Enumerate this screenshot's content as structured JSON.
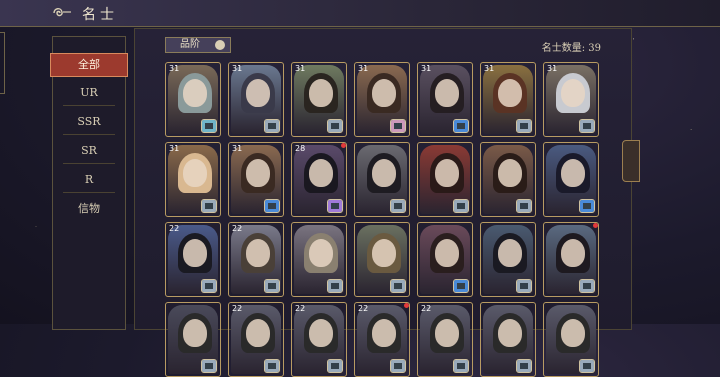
{
  "header": {
    "title": "名士"
  },
  "sidebar": {
    "items": [
      {
        "label": "全部",
        "selected": true
      },
      {
        "label": "UR"
      },
      {
        "label": "SSR"
      },
      {
        "label": "SR"
      },
      {
        "label": "R"
      },
      {
        "label": "信物"
      }
    ]
  },
  "filter": {
    "label": "品阶"
  },
  "count_text": "名士数量: 39",
  "cards": [
    {
      "level": "31",
      "hair": "#8a9a9a",
      "bg": "#7a6a58",
      "badge": "#6fb4c9"
    },
    {
      "level": "31",
      "hair": "#3a3a4a",
      "bg": "#6a7890",
      "badge": "#9ab"
    },
    {
      "level": "31",
      "hair": "#2a2520",
      "bg": "#6f7a60",
      "badge": "#9ab"
    },
    {
      "level": "31",
      "hair": "#3a2a22",
      "bg": "#8a6a50",
      "badge": "#c9b"
    },
    {
      "level": "31",
      "hair": "#251e22",
      "bg": "#5a5060",
      "badge": "#4a8ad8"
    },
    {
      "level": "31",
      "hair": "#5a3324",
      "bg": "#8a7040",
      "badge": "#9ab"
    },
    {
      "level": "31",
      "hair": "#c8cad0",
      "bg": "#7a7064",
      "badge": "#9ab"
    },
    {
      "level": "31",
      "hair": "#d9b890",
      "bg": "#8a6a4a",
      "badge": "#9ab"
    },
    {
      "level": "31",
      "hair": "#3a2a22",
      "bg": "#8a6a50",
      "badge": "#4a8ad8"
    },
    {
      "level": "28",
      "hair": "#1a1820",
      "bg": "#5a4a6a",
      "badge": "#a07ad8",
      "dot": true
    },
    {
      "level": "",
      "hair": "#1e1c22",
      "bg": "#6a6a70",
      "badge": "#9ab"
    },
    {
      "level": "",
      "hair": "#2a1a18",
      "bg": "#8a3a34",
      "badge": "#9ab"
    },
    {
      "level": "",
      "hair": "#2a1c18",
      "bg": "#7a5a48",
      "badge": "#9ab"
    },
    {
      "level": "",
      "hair": "#1a1a2a",
      "bg": "#4a5a80",
      "badge": "#4a8ad8"
    },
    {
      "level": "22",
      "hair": "#1a1a22",
      "bg": "#4a5a8a",
      "badge": "#9ab"
    },
    {
      "level": "22",
      "hair": "#4a4038",
      "bg": "#7a7a8a",
      "badge": "#9ab"
    },
    {
      "level": "",
      "hair": "#8a8070",
      "bg": "#7a7480",
      "badge": "#9ab"
    },
    {
      "level": "",
      "hair": "#6a5a40",
      "bg": "#6a7060",
      "badge": "#9ab"
    },
    {
      "level": "",
      "hair": "#2a1e1e",
      "bg": "#6a4a5a",
      "badge": "#4a8ad8"
    },
    {
      "level": "",
      "hair": "#1a1a22",
      "bg": "#4a5a70",
      "badge": "#9ab"
    },
    {
      "level": "",
      "hair": "#1e1a20",
      "bg": "#5a6a80",
      "badge": "#9ab",
      "dot": true
    },
    {
      "level": "",
      "hair": "#2a2a2a",
      "bg": "#4a4a5a",
      "badge": "#9ab"
    },
    {
      "level": "22",
      "hair": "#2a2a2a",
      "bg": "#5a5a6a",
      "badge": "#9ab"
    },
    {
      "level": "22",
      "hair": "#2a2a2a",
      "bg": "#5a5a6a",
      "badge": "#9ab"
    },
    {
      "level": "22",
      "hair": "#2a2a2a",
      "bg": "#5a5a6a",
      "badge": "#9ab",
      "dot": true
    },
    {
      "level": "22",
      "hair": "#2a2a2a",
      "bg": "#5a5a6a",
      "badge": "#9ab"
    },
    {
      "level": "",
      "hair": "#2a2a2a",
      "bg": "#5a5a6a",
      "badge": "#9ab"
    },
    {
      "level": "",
      "hair": "#2a2a2a",
      "bg": "#5a5a6a",
      "badge": "#9ab"
    }
  ]
}
